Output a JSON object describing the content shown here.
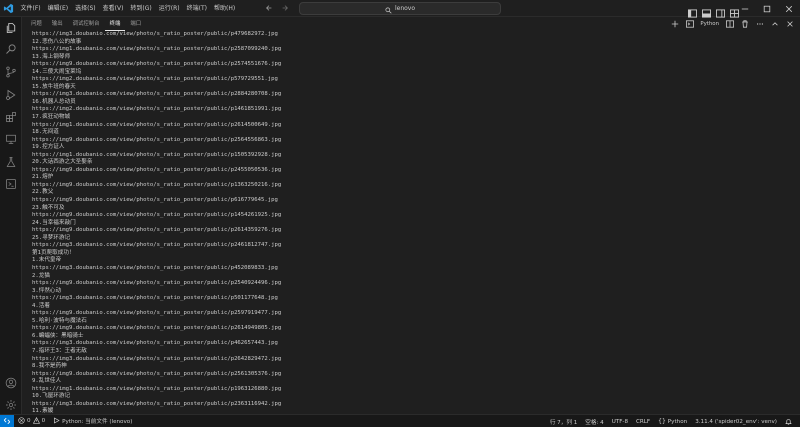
{
  "menu": [
    "文件(F)",
    "编辑(E)",
    "选择(S)",
    "查看(V)",
    "转到(G)",
    "运行(R)",
    "终端(T)",
    "帮助(H)"
  ],
  "search": {
    "text": "lenovo"
  },
  "panel": {
    "tabs": [
      "问题",
      "输出",
      "调试控制台",
      "终端",
      "端口"
    ],
    "active_tab": "终端",
    "python_label": "Python"
  },
  "terminal_lines": [
    "https://img3.doubanio.com/view/photo/s_ratio_poster/public/p479682972.jpg",
    "12.悲伤八公的故事",
    "https://img1.doubanio.com/view/photo/s_ratio_poster/public/p2587099240.jpg",
    "13.海上钢琴师",
    "https://img9.doubanio.com/view/photo/s_ratio_poster/public/p2574551676.jpg",
    "14.三傻大闹宝莱坞",
    "https://img2.doubanio.com/view/photo/s_ratio_poster/public/p579729551.jpg",
    "15.放牛班的春天",
    "https://img3.doubanio.com/view/photo/s_ratio_poster/public/p2884280708.jpg",
    "16.机器人总动员",
    "https://img2.doubanio.com/view/photo/s_ratio_poster/public/p1461851991.jpg",
    "17.疯狂动物城",
    "https://img1.doubanio.com/view/photo/s_ratio_poster/public/p2614500649.jpg",
    "18.无间道",
    "https://img9.doubanio.com/view/photo/s_ratio_poster/public/p2564556863.jpg",
    "19.控方证人",
    "https://img1.doubanio.com/view/photo/s_ratio_poster/public/p1505392928.jpg",
    "20.大话西游之大圣娶亲",
    "https://img9.doubanio.com/view/photo/s_ratio_poster/public/p2455050536.jpg",
    "21.熔炉",
    "https://img9.doubanio.com/view/photo/s_ratio_poster/public/p1363250216.jpg",
    "22.教父",
    "https://img9.doubanio.com/view/photo/s_ratio_poster/public/p616779645.jpg",
    "23.触不可及",
    "https://img9.doubanio.com/view/photo/s_ratio_poster/public/p1454261925.jpg",
    "24.当幸福来敲门",
    "https://img9.doubanio.com/view/photo/s_ratio_poster/public/p2614359276.jpg",
    "25.寻梦环游记",
    "https://img3.doubanio.com/view/photo/s_ratio_poster/public/p2461812747.jpg",
    "第1页爬取成功！",
    "1.末代皇帝",
    "https://img3.doubanio.com/view/photo/s_ratio_poster/public/p452089833.jpg",
    "2.龙猫",
    "https://img9.doubanio.com/view/photo/s_ratio_poster/public/p2540924496.jpg",
    "3.怦然心动",
    "https://img3.doubanio.com/view/photo/s_ratio_poster/public/p501177648.jpg",
    "4.活着",
    "https://img9.doubanio.com/view/photo/s_ratio_poster/public/p2597919477.jpg",
    "5.哈利·波特与魔法石",
    "https://img9.doubanio.com/view/photo/s_ratio_poster/public/p2614949805.jpg",
    "6.蝙蝠侠：黑暗骑士",
    "https://img3.doubanio.com/view/photo/s_ratio_poster/public/p462657443.jpg",
    "7.指环王3：王者无敌",
    "https://img3.doubanio.com/view/photo/s_ratio_poster/public/p2642829472.jpg",
    "8.我不是药神",
    "https://img9.doubanio.com/view/photo/s_ratio_poster/public/p2561305376.jpg",
    "9.乱世佳人",
    "https://img1.doubanio.com/view/photo/s_ratio_poster/public/p1963126880.jpg",
    "10.飞屋环游记",
    "https://img3.doubanio.com/view/photo/s_ratio_poster/public/p2363116942.jpg",
    "11.素媛"
  ],
  "status": {
    "errors": "0",
    "warnings": "0",
    "python_file": "Python: 当前文件 (lenovo)",
    "position": "行 7，列 1",
    "spaces": "空格: 4",
    "encoding": "UTF-8",
    "eol": "CRLF",
    "language": "Python",
    "interpreter": "3.11.4 ('spider02_env': venv)"
  },
  "colors": {
    "accent": "#0078d4",
    "background": "#1f1f1f",
    "text": "#cccccc"
  }
}
